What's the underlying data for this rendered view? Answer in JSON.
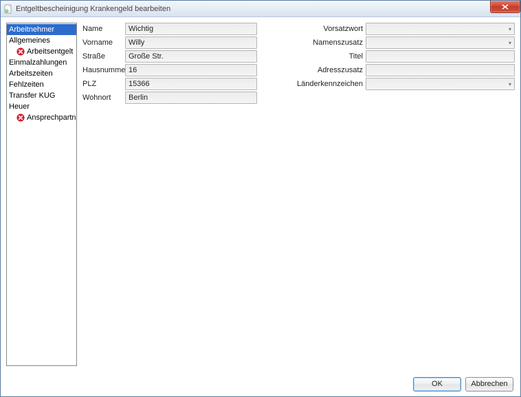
{
  "window": {
    "title": "Entgeltbescheinigung Krankengeld bearbeiten"
  },
  "sidebar": {
    "items": [
      {
        "label": "Arbeitnehmer",
        "selected": true,
        "error": false,
        "indent": 0
      },
      {
        "label": "Allgemeines",
        "selected": false,
        "error": false,
        "indent": 0
      },
      {
        "label": "Arbeitsentgelt",
        "selected": false,
        "error": true,
        "indent": 1
      },
      {
        "label": "Einmalzahlungen",
        "selected": false,
        "error": false,
        "indent": 0
      },
      {
        "label": "Arbeitszeiten",
        "selected": false,
        "error": false,
        "indent": 0
      },
      {
        "label": "Fehlzeiten",
        "selected": false,
        "error": false,
        "indent": 0
      },
      {
        "label": "Transfer KUG",
        "selected": false,
        "error": false,
        "indent": 0
      },
      {
        "label": "Heuer",
        "selected": false,
        "error": false,
        "indent": 0
      },
      {
        "label": "Ansprechpartner",
        "selected": false,
        "error": true,
        "indent": 1
      }
    ]
  },
  "form": {
    "left": {
      "name": {
        "label": "Name",
        "value": "Wichtig"
      },
      "vorname": {
        "label": "Vorname",
        "value": "Willy"
      },
      "strasse": {
        "label": "Straße",
        "value": "Große Str."
      },
      "hausnummer": {
        "label": "Hausnummer",
        "value": "16"
      },
      "plz": {
        "label": "PLZ",
        "value": "15366"
      },
      "wohnort": {
        "label": "Wohnort",
        "value": "Berlin"
      }
    },
    "right": {
      "vorsatzwort": {
        "label": "Vorsatzwort",
        "value": ""
      },
      "namenszusatz": {
        "label": "Namenszusatz",
        "value": ""
      },
      "titel": {
        "label": "Titel",
        "value": ""
      },
      "adresszusatz": {
        "label": "Adresszusatz",
        "value": ""
      },
      "laenderkennzeichen": {
        "label": "Länderkennzeichen",
        "value": ""
      }
    }
  },
  "buttons": {
    "ok": "OK",
    "cancel": "Abbrechen"
  }
}
